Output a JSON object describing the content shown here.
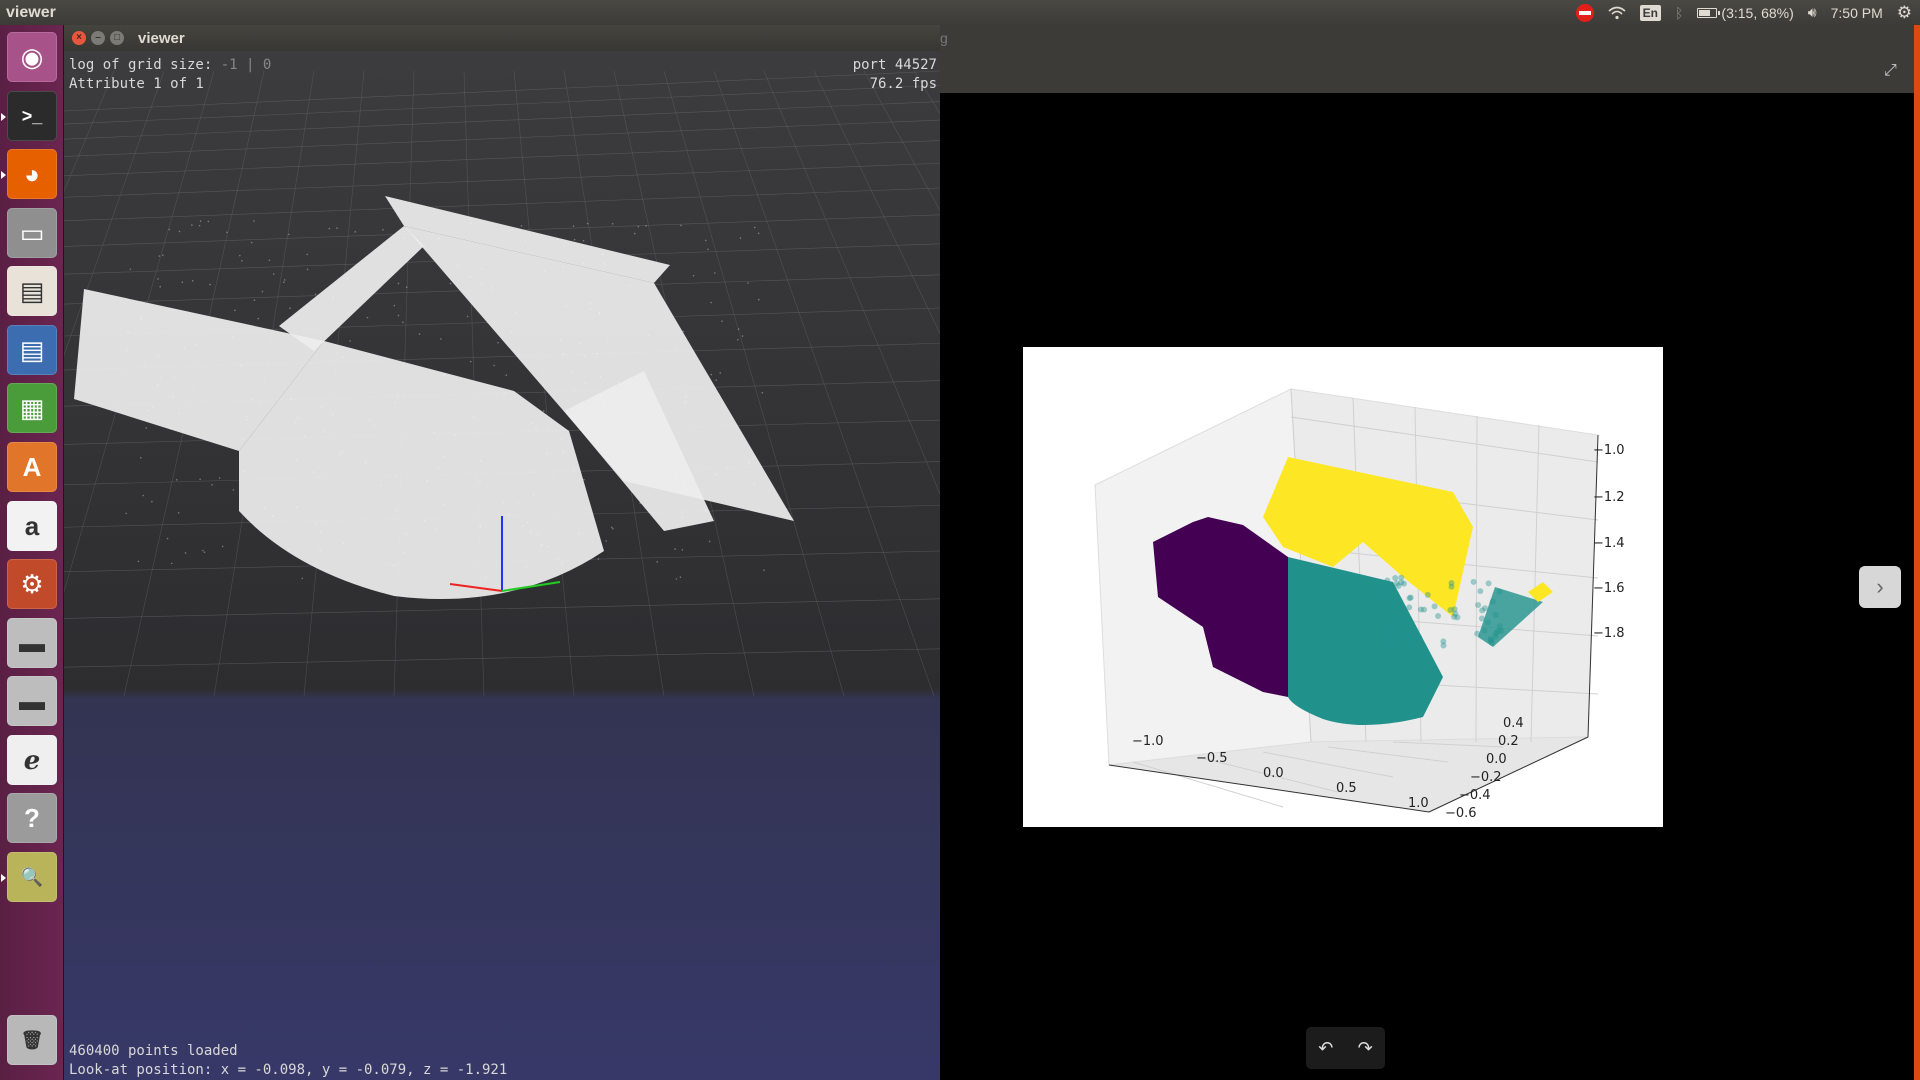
{
  "panel": {
    "app_title": "viewer",
    "language": "En",
    "battery": "(3:15, 68%)",
    "clock": "7:50 PM"
  },
  "launcher": {
    "items": [
      {
        "name": "ubuntu-dash",
        "icon": "ubuntu-logo-icon",
        "glyph": "◉",
        "bg": "#a8528a"
      },
      {
        "name": "terminal",
        "icon": "terminal-icon",
        "glyph": ">_",
        "bg": "#2b2b2b"
      },
      {
        "name": "firefox",
        "icon": "firefox-icon",
        "glyph": "◕",
        "bg": "#e66000"
      },
      {
        "name": "files",
        "icon": "files-icon",
        "glyph": "▭",
        "bg": "#8f8f8f"
      },
      {
        "name": "impress",
        "icon": "presentation-icon",
        "glyph": "▤",
        "bg": "#e8e2d8"
      },
      {
        "name": "writer",
        "icon": "writer-document-icon",
        "glyph": "▤",
        "bg": "#3c6db0"
      },
      {
        "name": "calc",
        "icon": "spreadsheet-icon",
        "glyph": "▦",
        "bg": "#4a9b3a"
      },
      {
        "name": "software",
        "icon": "software-center-icon",
        "glyph": "A",
        "bg": "#e1752a"
      },
      {
        "name": "amazon",
        "icon": "amazon-icon",
        "glyph": "a",
        "bg": "#f2f2f2"
      },
      {
        "name": "settings",
        "icon": "settings-icon",
        "glyph": "⚙",
        "bg": "#c14a2a"
      },
      {
        "name": "disk-1",
        "icon": "disk-drive-icon",
        "glyph": "▬",
        "bg": "#bdbdbd"
      },
      {
        "name": "disk-2",
        "icon": "disk-drive-icon",
        "glyph": "▬",
        "bg": "#bdbdbd"
      },
      {
        "name": "document-viewer",
        "icon": "pdf-viewer-icon",
        "glyph": "ℯ",
        "bg": "#efefef"
      },
      {
        "name": "help",
        "icon": "help-icon",
        "glyph": "?",
        "bg": "#9b9b9b"
      },
      {
        "name": "image-viewer",
        "icon": "image-viewer-icon",
        "glyph": "🔍",
        "bg": "#b9b35a"
      },
      {
        "name": "trash",
        "icon": "trash-icon",
        "glyph": "🗑",
        "bg": "#b8b8b8"
      }
    ]
  },
  "viewer": {
    "window_title": "viewer",
    "hud": {
      "grid_label": "log of grid size: ",
      "grid_value": "-1 | 0",
      "attribute": "Attribute 1 of 1",
      "port": "port 44527",
      "fps": "76.2 fps",
      "points_loaded": "460400 points loaded",
      "look_at": "Look-at position: x = -0.098, y = -0.079, z = -1.921"
    }
  },
  "image_viewer": {
    "ghost_title": "g",
    "next_glyph": "›",
    "rotate_left_glyph": "↶",
    "rotate_right_glyph": "↷"
  },
  "chart_data": {
    "type": "scatter",
    "title": "",
    "xlabel": "",
    "ylabel": "",
    "zlabel": "",
    "x_ticks": [
      "−1.0",
      "−0.5",
      "0.0",
      "0.5",
      "1.0"
    ],
    "y_ticks": [
      "−0.6",
      "−0.4",
      "−0.2",
      "0.0",
      "0.2",
      "0.4"
    ],
    "z_ticks": [
      "−1.8",
      "−1.6",
      "−1.4",
      "−1.2",
      "−1.0"
    ],
    "series_colors": [
      "#440154",
      "#21918c",
      "#fde725"
    ],
    "grid": true
  }
}
